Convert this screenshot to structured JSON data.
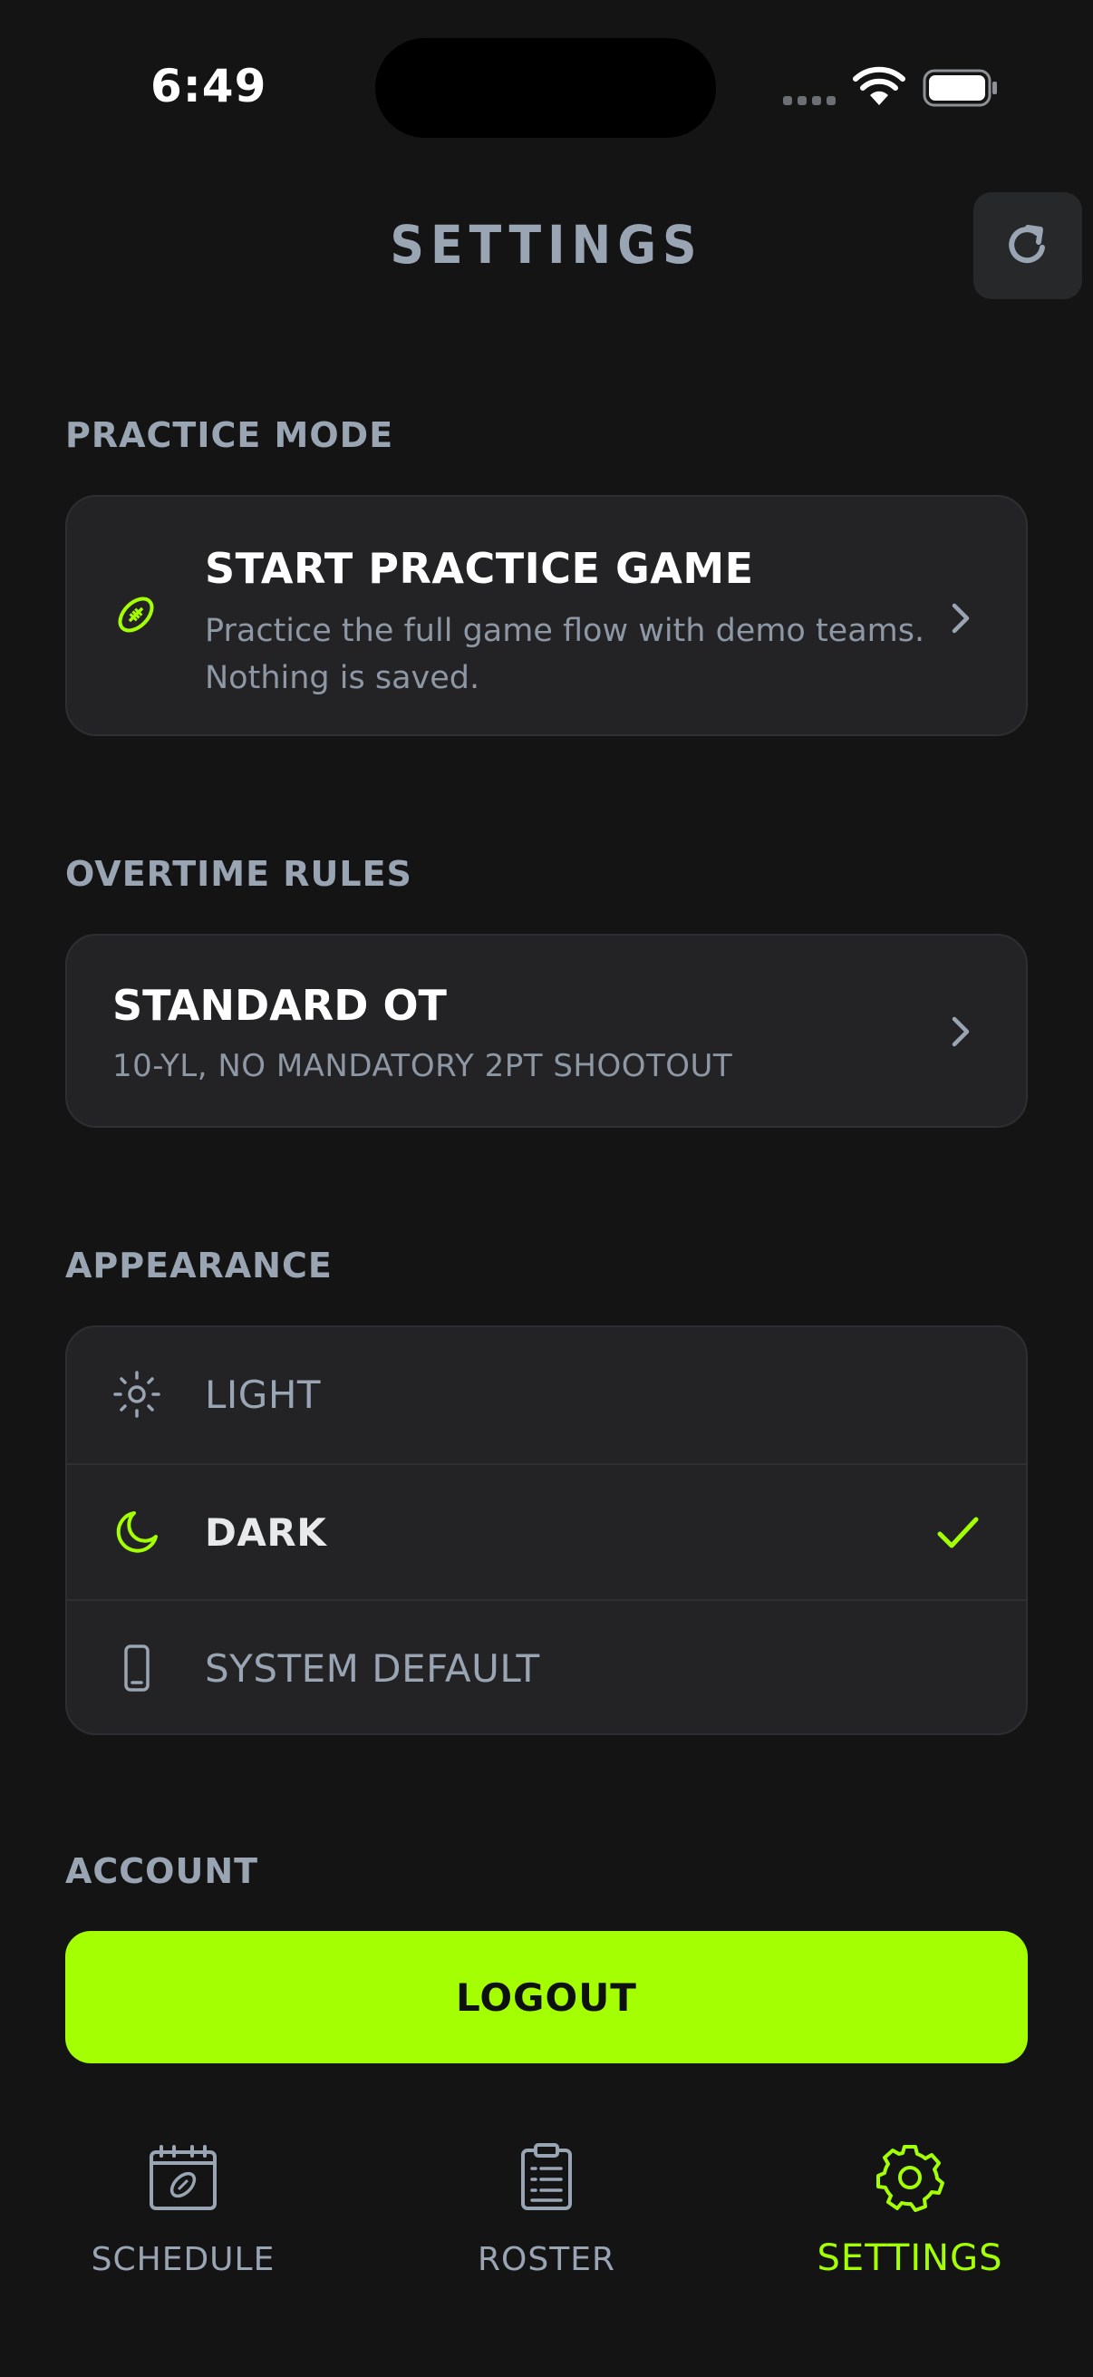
{
  "status_bar": {
    "time": "6:49"
  },
  "header": {
    "title": "SETTINGS",
    "refresh_icon": "refresh-icon"
  },
  "practice_mode": {
    "section_label": "PRACTICE MODE",
    "title": "START PRACTICE GAME",
    "description": "Practice the full game flow with demo teams. Nothing is saved.",
    "icon": "football-icon"
  },
  "overtime": {
    "section_label": "OVERTIME RULES",
    "title": "STANDARD OT",
    "subtitle": "10-YL, NO MANDATORY 2PT SHOOTOUT"
  },
  "appearance": {
    "section_label": "APPEARANCE",
    "options": [
      {
        "label": "LIGHT",
        "icon": "sun-icon",
        "selected": false
      },
      {
        "label": "DARK",
        "icon": "moon-icon",
        "selected": true
      },
      {
        "label": "SYSTEM DEFAULT",
        "icon": "phone-icon",
        "selected": false
      }
    ]
  },
  "account": {
    "section_label": "ACCOUNT",
    "logout_label": "LOGOUT"
  },
  "tabs": [
    {
      "label": "SCHEDULE",
      "icon": "calendar-football-icon",
      "active": false
    },
    {
      "label": "ROSTER",
      "icon": "clipboard-icon",
      "active": false
    },
    {
      "label": "SETTINGS",
      "icon": "gear-icon",
      "active": true
    }
  ],
  "colors": {
    "accent": "#a3ff02",
    "background": "#141415",
    "card": "#232325",
    "muted": "#9aa5b4"
  }
}
